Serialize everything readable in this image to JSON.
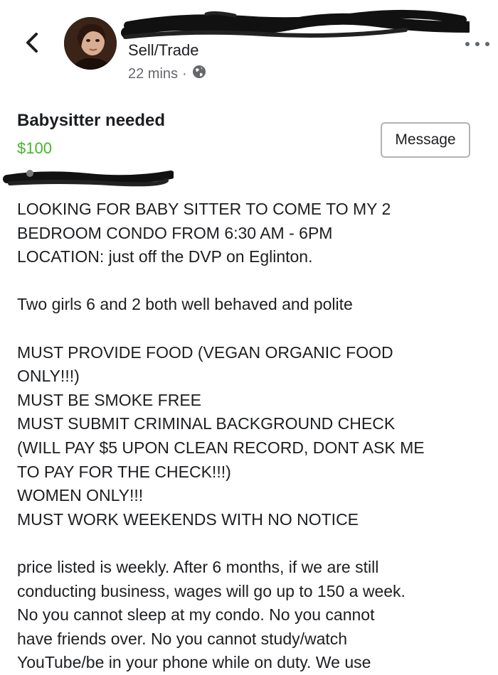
{
  "header": {
    "group_name": "Sell/Trade",
    "time": "22 mins",
    "separator": "·",
    "privacy_icon": "globe-icon",
    "back_icon": "chevron-left-icon",
    "more_icon": "more-horizontal-icon"
  },
  "listing": {
    "title": "Babysitter needed",
    "price": "$100",
    "message_button": "Message"
  },
  "post": {
    "lines": [
      "LOOKING FOR BABY SITTER TO COME TO MY 2",
      "BEDROOM CONDO FROM 6:30 AM - 6PM",
      "LOCATION: just off the DVP on Eglinton.",
      "",
      "Two girls 6 and 2 both well behaved and polite",
      "",
      "MUST PROVIDE FOOD (VEGAN ORGANIC FOOD",
      "ONLY!!!)",
      "MUST BE SMOKE FREE",
      "MUST SUBMIT CRIMINAL BACKGROUND CHECK",
      "(WILL PAY $5 UPON CLEAN RECORD, DONT ASK ME",
      "TO PAY FOR THE CHECK!!!)",
      "WOMEN ONLY!!!",
      "MUST WORK WEEKENDS WITH NO NOTICE",
      "",
      "price listed is weekly. After 6 months, if we are still",
      "conducting business, wages will go up to 150 a week.",
      "No you cannot sleep at my condo. No you cannot",
      "have friends over. No you cannot study/watch",
      "YouTube/be in your phone while on duty. We use"
    ]
  },
  "colors": {
    "price": "#42b72a",
    "meta_text": "#65676b",
    "redaction": "#111111"
  }
}
